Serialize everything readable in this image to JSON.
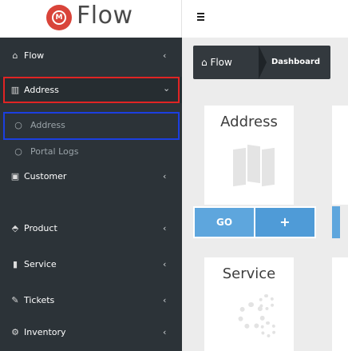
{
  "header": {
    "logo_text": "Flow",
    "logo_mark": "M",
    "menu_icon": "hamburger-icon"
  },
  "sidebar": {
    "items": [
      {
        "label": "Flow",
        "icon": "home-icon"
      },
      {
        "label": "Address",
        "icon": "map-icon"
      },
      {
        "label": "Address",
        "icon": "circle-icon"
      },
      {
        "label": "Portal Logs",
        "icon": "circle-icon"
      },
      {
        "label": "Customer",
        "icon": "id-card-icon"
      },
      {
        "label": "Product",
        "icon": "box-icon"
      },
      {
        "label": "Service",
        "icon": "bar-chart-icon"
      },
      {
        "label": "Tickets",
        "icon": "ticket-icon"
      },
      {
        "label": "Inventory",
        "icon": "cogs-icon"
      }
    ],
    "chevron_left": "‹",
    "chevron_down": "⌄"
  },
  "breadcrumb": {
    "home": "Flow",
    "current": "Dashboard"
  },
  "cards": {
    "address_title": "Address",
    "service_title": "Service"
  },
  "actions": {
    "go_label": "GO",
    "plus_label": "+"
  },
  "colors": {
    "sidebar_bg": "#2c3338",
    "accent_blue": "#5ea6dd",
    "logo_red": "#d9443a",
    "highlight_red": "#e02424",
    "highlight_blue": "#1b3fe0"
  }
}
